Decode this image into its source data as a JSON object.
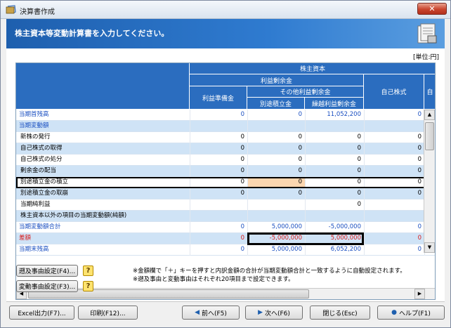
{
  "window": {
    "title": "決算書作成",
    "close_label": "✕"
  },
  "banner": {
    "text": "株主資本等変動計算書を入力してください。"
  },
  "unit_label": "[単位:円]",
  "headers": {
    "top": "株主資本",
    "retained": "利益剰余金",
    "other_retained": "その他利益剰余金",
    "legal_reserve": "利益準備金",
    "special_reserve": "別途積立金",
    "carried_forward": "繰越利益剰余金",
    "treasury": "自己株式",
    "cut": "自"
  },
  "rows": [
    {
      "label": "当期首残高",
      "style": "blue",
      "alt": false,
      "v1": "0",
      "v2": "0",
      "v3": "11,052,200",
      "v4": "0",
      "v1s": "blue",
      "v2s": "blue",
      "v3s": "blue",
      "v4s": "blue"
    },
    {
      "label": "当期変動額",
      "style": "blue",
      "alt": true,
      "v1": "",
      "v2": "",
      "v3": "",
      "v4": ""
    },
    {
      "label": "新株の発行",
      "style": "ind",
      "alt": false,
      "v1": "0",
      "v2": "0",
      "v3": "0",
      "v4": "0"
    },
    {
      "label": "自己株式の取得",
      "style": "ind",
      "alt": true,
      "v1": "0",
      "v2": "0",
      "v3": "0",
      "v4": "0"
    },
    {
      "label": "自己株式の処分",
      "style": "ind",
      "alt": false,
      "v1": "0",
      "v2": "0",
      "v3": "0",
      "v4": "0"
    },
    {
      "label": "剰余金の配当",
      "style": "ind",
      "alt": true,
      "v1": "0",
      "v2": "0",
      "v3": "0",
      "v4": "0"
    },
    {
      "label": "別途積立金の積立",
      "style": "ind",
      "alt": false,
      "v1": "0",
      "v2": "0",
      "v3": "0",
      "v4": "0",
      "edit": true
    },
    {
      "label": "別途積立金の取崩",
      "style": "ind",
      "alt": true,
      "v1": "0",
      "v2": "0",
      "v3": "0",
      "v4": "0"
    },
    {
      "label": "当期純利益",
      "style": "ind",
      "alt": false,
      "v1": "",
      "v2": "",
      "v3": "0",
      "v4": ""
    },
    {
      "label": "株主資本以外の項目の当期変動額(純額)",
      "style": "ind",
      "alt": true,
      "v1": "",
      "v2": "",
      "v3": "",
      "v4": ""
    },
    {
      "label": "当期変動額合計",
      "style": "blue",
      "alt": false,
      "v1": "0",
      "v2": "5,000,000",
      "v3": "-5,000,000",
      "v4": "0",
      "v1s": "blue",
      "v2s": "blue",
      "v3s": "blue",
      "v4s": "blue"
    },
    {
      "label": "差額",
      "style": "red",
      "alt": true,
      "v1": "0",
      "v2": "-5,000,000",
      "v3": "5,000,000",
      "v4": "0",
      "v1s": "red",
      "v2s": "red",
      "v3s": "red",
      "v4s": "red"
    },
    {
      "label": "当期末残高",
      "style": "blue",
      "alt": false,
      "v1": "0",
      "v2": "5,000,000",
      "v3": "6,052,200",
      "v4": "0",
      "v1s": "blue",
      "v2s": "blue",
      "v3s": "blue",
      "v4s": "blue"
    }
  ],
  "side_buttons": {
    "retro": "遡及事由設定(F4)...",
    "change": "変動事由設定(F3)..."
  },
  "help_icon": "?",
  "notes": {
    "line1": "※金額欄で「＋」キーを押すと内訳金額の合計が当期変動額合計と一致するように自動設定されます。",
    "line2": "※遡及事由と変動事由はそれぞれ20項目まで設定できます。"
  },
  "footer": {
    "excel": "Excel出力(F7)...",
    "print": "印刷(F12)...",
    "prev": "前へ(F5)",
    "next": "次へ(F6)",
    "close": "閉じる(Esc)",
    "help": "ヘルプ(F1)"
  },
  "colors": {
    "header_blue": "#2b6dbf",
    "label_blue": "#1a4fc1",
    "diff_red": "#d91a1a",
    "alt_row": "#cfe3f6"
  }
}
